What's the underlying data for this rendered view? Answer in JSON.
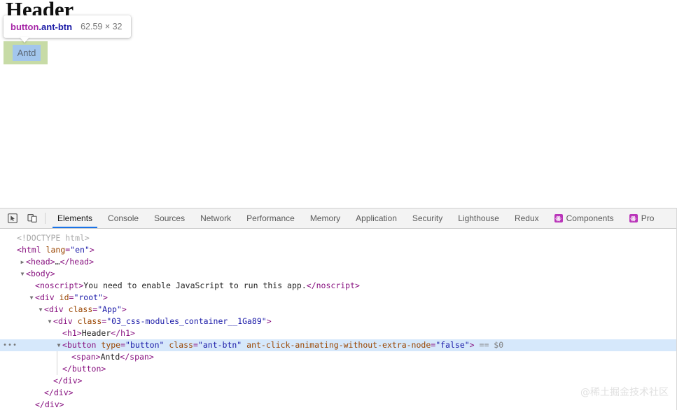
{
  "page": {
    "heading": "Header",
    "button_label": "Antd"
  },
  "inspect_tooltip": {
    "tag_name": "button",
    "class_name": ".ant-btn",
    "dimensions": "62.59 × 32",
    "tag_color": "#a625a6",
    "class_color": "#1a1aa6",
    "dim_color": "#777777",
    "padding_box_color": "#c7dba6",
    "content_box_color": "#a3c6ed"
  },
  "devtools": {
    "toolbar_icons": [
      {
        "name": "inspect-element-icon",
        "title": "Inspect element"
      },
      {
        "name": "device-toolbar-icon",
        "title": "Toggle device toolbar"
      }
    ],
    "tabs": [
      {
        "label": "Elements",
        "active": true,
        "icon": null
      },
      {
        "label": "Console",
        "active": false,
        "icon": null
      },
      {
        "label": "Sources",
        "active": false,
        "icon": null
      },
      {
        "label": "Network",
        "active": false,
        "icon": null
      },
      {
        "label": "Performance",
        "active": false,
        "icon": null
      },
      {
        "label": "Memory",
        "active": false,
        "icon": null
      },
      {
        "label": "Application",
        "active": false,
        "icon": null
      },
      {
        "label": "Security",
        "active": false,
        "icon": null
      },
      {
        "label": "Lighthouse",
        "active": false,
        "icon": null
      },
      {
        "label": "Redux",
        "active": false,
        "icon": null
      },
      {
        "label": "Components",
        "active": false,
        "icon": "react-icon"
      },
      {
        "label": "Pro",
        "active": false,
        "icon": "react-icon"
      }
    ],
    "active_tab_underline_color": "#1a73e8",
    "react_icon_color": "#b934b9"
  },
  "dom_tree": {
    "selected_row_color": "#d6e8fb",
    "selection_marker": "== $0",
    "overflow_badge": "•••",
    "rows": [
      {
        "indent": 0,
        "twisty": "none",
        "parts": [
          {
            "cls": "doctype",
            "t": "<!DOCTYPE html>"
          }
        ]
      },
      {
        "indent": 0,
        "twisty": "none",
        "parts": [
          {
            "cls": "punct",
            "t": "<"
          },
          {
            "cls": "tagn",
            "t": "html"
          },
          {
            "cls": "attrn",
            "t": " lang"
          },
          {
            "cls": "punct",
            "t": "="
          },
          {
            "cls": "attrv",
            "t": "\"en\""
          },
          {
            "cls": "punct",
            "t": ">"
          }
        ]
      },
      {
        "indent": 1,
        "twisty": "closed",
        "parts": [
          {
            "cls": "punct",
            "t": "<"
          },
          {
            "cls": "tagn",
            "t": "head"
          },
          {
            "cls": "punct",
            "t": ">"
          },
          {
            "cls": "textn",
            "t": "…"
          },
          {
            "cls": "punct",
            "t": "</"
          },
          {
            "cls": "tagn",
            "t": "head"
          },
          {
            "cls": "punct",
            "t": ">"
          }
        ]
      },
      {
        "indent": 1,
        "twisty": "open",
        "parts": [
          {
            "cls": "punct",
            "t": "<"
          },
          {
            "cls": "tagn",
            "t": "body"
          },
          {
            "cls": "punct",
            "t": ">"
          }
        ]
      },
      {
        "indent": 2,
        "twisty": "none",
        "parts": [
          {
            "cls": "punct",
            "t": "<"
          },
          {
            "cls": "tagn",
            "t": "noscript"
          },
          {
            "cls": "punct",
            "t": ">"
          },
          {
            "cls": "textn",
            "t": "You need to enable JavaScript to run this app."
          },
          {
            "cls": "punct",
            "t": "</"
          },
          {
            "cls": "tagn",
            "t": "noscript"
          },
          {
            "cls": "punct",
            "t": ">"
          }
        ]
      },
      {
        "indent": 2,
        "twisty": "open",
        "parts": [
          {
            "cls": "punct",
            "t": "<"
          },
          {
            "cls": "tagn",
            "t": "div"
          },
          {
            "cls": "attrn",
            "t": " id"
          },
          {
            "cls": "punct",
            "t": "="
          },
          {
            "cls": "attrv",
            "t": "\"root\""
          },
          {
            "cls": "punct",
            "t": ">"
          }
        ]
      },
      {
        "indent": 3,
        "twisty": "open",
        "parts": [
          {
            "cls": "punct",
            "t": "<"
          },
          {
            "cls": "tagn",
            "t": "div"
          },
          {
            "cls": "attrn",
            "t": " class"
          },
          {
            "cls": "punct",
            "t": "="
          },
          {
            "cls": "attrv",
            "t": "\"App\""
          },
          {
            "cls": "punct",
            "t": ">"
          }
        ]
      },
      {
        "indent": 4,
        "twisty": "open",
        "parts": [
          {
            "cls": "punct",
            "t": "<"
          },
          {
            "cls": "tagn",
            "t": "div"
          },
          {
            "cls": "attrn",
            "t": " class"
          },
          {
            "cls": "punct",
            "t": "="
          },
          {
            "cls": "attrv",
            "t": "\"03_css-modules_container__1Ga89\""
          },
          {
            "cls": "punct",
            "t": ">"
          }
        ]
      },
      {
        "indent": 5,
        "twisty": "none",
        "parts": [
          {
            "cls": "punct",
            "t": "<"
          },
          {
            "cls": "tagn",
            "t": "h1"
          },
          {
            "cls": "punct",
            "t": ">"
          },
          {
            "cls": "textn",
            "t": "Header"
          },
          {
            "cls": "punct",
            "t": "</"
          },
          {
            "cls": "tagn",
            "t": "h1"
          },
          {
            "cls": "punct",
            "t": ">"
          }
        ]
      },
      {
        "indent": 5,
        "twisty": "open",
        "selected": true,
        "badge": true,
        "parts": [
          {
            "cls": "punct",
            "t": "<"
          },
          {
            "cls": "tagn",
            "t": "button"
          },
          {
            "cls": "attrn",
            "t": " type"
          },
          {
            "cls": "punct",
            "t": "="
          },
          {
            "cls": "attrv",
            "t": "\"button\""
          },
          {
            "cls": "attrn",
            "t": " class"
          },
          {
            "cls": "punct",
            "t": "="
          },
          {
            "cls": "attrv",
            "t": "\"ant-btn\""
          },
          {
            "cls": "attrn",
            "t": " ant-click-animating-without-extra-node"
          },
          {
            "cls": "punct",
            "t": "="
          },
          {
            "cls": "attrv",
            "t": "\"false\""
          },
          {
            "cls": "punct",
            "t": ">"
          },
          {
            "cls": "dollar",
            "t": "  == $0"
          }
        ]
      },
      {
        "indent": 6,
        "twisty": "none",
        "parts": [
          {
            "cls": "punct",
            "t": "<"
          },
          {
            "cls": "tagn",
            "t": "span"
          },
          {
            "cls": "punct",
            "t": ">"
          },
          {
            "cls": "textn",
            "t": "Antd"
          },
          {
            "cls": "punct",
            "t": "</"
          },
          {
            "cls": "tagn",
            "t": "span"
          },
          {
            "cls": "punct",
            "t": ">"
          }
        ]
      },
      {
        "indent": 5,
        "twisty": "none",
        "parts": [
          {
            "cls": "punct",
            "t": "</"
          },
          {
            "cls": "tagn",
            "t": "button"
          },
          {
            "cls": "punct",
            "t": ">"
          }
        ]
      },
      {
        "indent": 4,
        "twisty": "none",
        "parts": [
          {
            "cls": "punct",
            "t": "</"
          },
          {
            "cls": "tagn",
            "t": "div"
          },
          {
            "cls": "punct",
            "t": ">"
          }
        ]
      },
      {
        "indent": 3,
        "twisty": "none",
        "parts": [
          {
            "cls": "punct",
            "t": "</"
          },
          {
            "cls": "tagn",
            "t": "div"
          },
          {
            "cls": "punct",
            "t": ">"
          }
        ]
      },
      {
        "indent": 2,
        "twisty": "none",
        "parts": [
          {
            "cls": "punct",
            "t": "</"
          },
          {
            "cls": "tagn",
            "t": "div"
          },
          {
            "cls": "punct",
            "t": ">"
          }
        ]
      }
    ]
  },
  "watermark": {
    "text": "@稀土掘金技术社区"
  }
}
